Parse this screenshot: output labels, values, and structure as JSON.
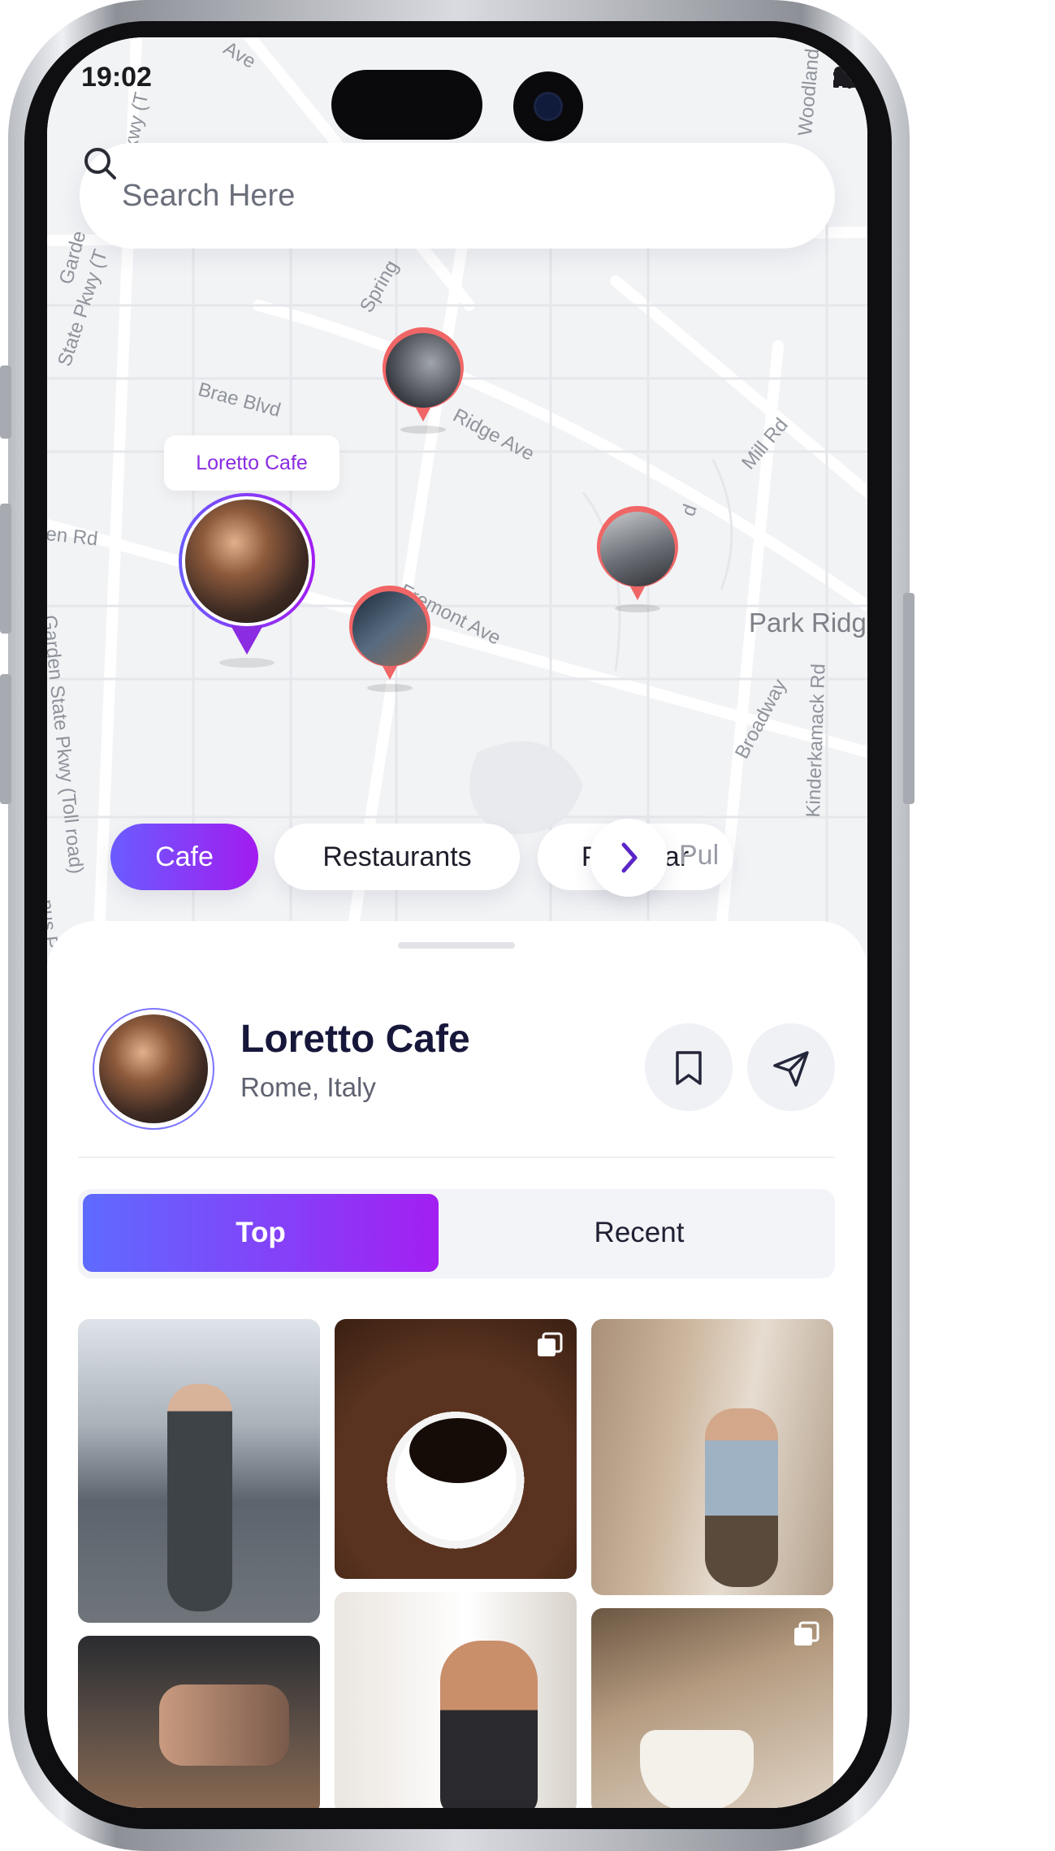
{
  "status": {
    "time": "19:02"
  },
  "search": {
    "placeholder": "Search Here"
  },
  "map": {
    "streets": [
      "Ave",
      "Pkwy (T",
      "Garde",
      "State Pkwy (T",
      "Spring",
      "Brae Blvd",
      "Ridge Ave",
      "Mill Rd",
      "en Rd",
      "Fremont Ave",
      "Garden State Pkwy (Toll road)",
      "Broadway",
      "Kinderkamack Rd",
      "Woodland",
      "nus P",
      "d"
    ],
    "area_label": "Park Ridg",
    "tooltip": "Loretto Cafe"
  },
  "categories": {
    "items": [
      "Cafe",
      "Restaurants",
      "Pub/ Bar"
    ],
    "partial": "Pul",
    "active": "Cafe"
  },
  "place": {
    "name": "Loretto Cafe",
    "location": "Rome, Italy"
  },
  "tabs": {
    "top": "Top",
    "recent": "Recent",
    "active": "Top"
  },
  "gallery": {
    "items": [
      "man-walking-street-photo",
      "coffee-cup-beans-photo",
      "traveler-alley-photo",
      "friends-at-bar-photo",
      "man-holding-coffee-photo",
      "latte-cup-cafe-photo"
    ]
  },
  "colors": {
    "accent_start": "#6a5cff",
    "accent_end": "#a21cf0",
    "pin_red": "#f06666",
    "text_dark": "#17173b"
  },
  "icons": [
    "search-icon",
    "bookmark-icon",
    "send-icon",
    "chevron-right-icon",
    "signal-icon",
    "wifi-icon",
    "battery-icon",
    "multi-photo-icon"
  ]
}
